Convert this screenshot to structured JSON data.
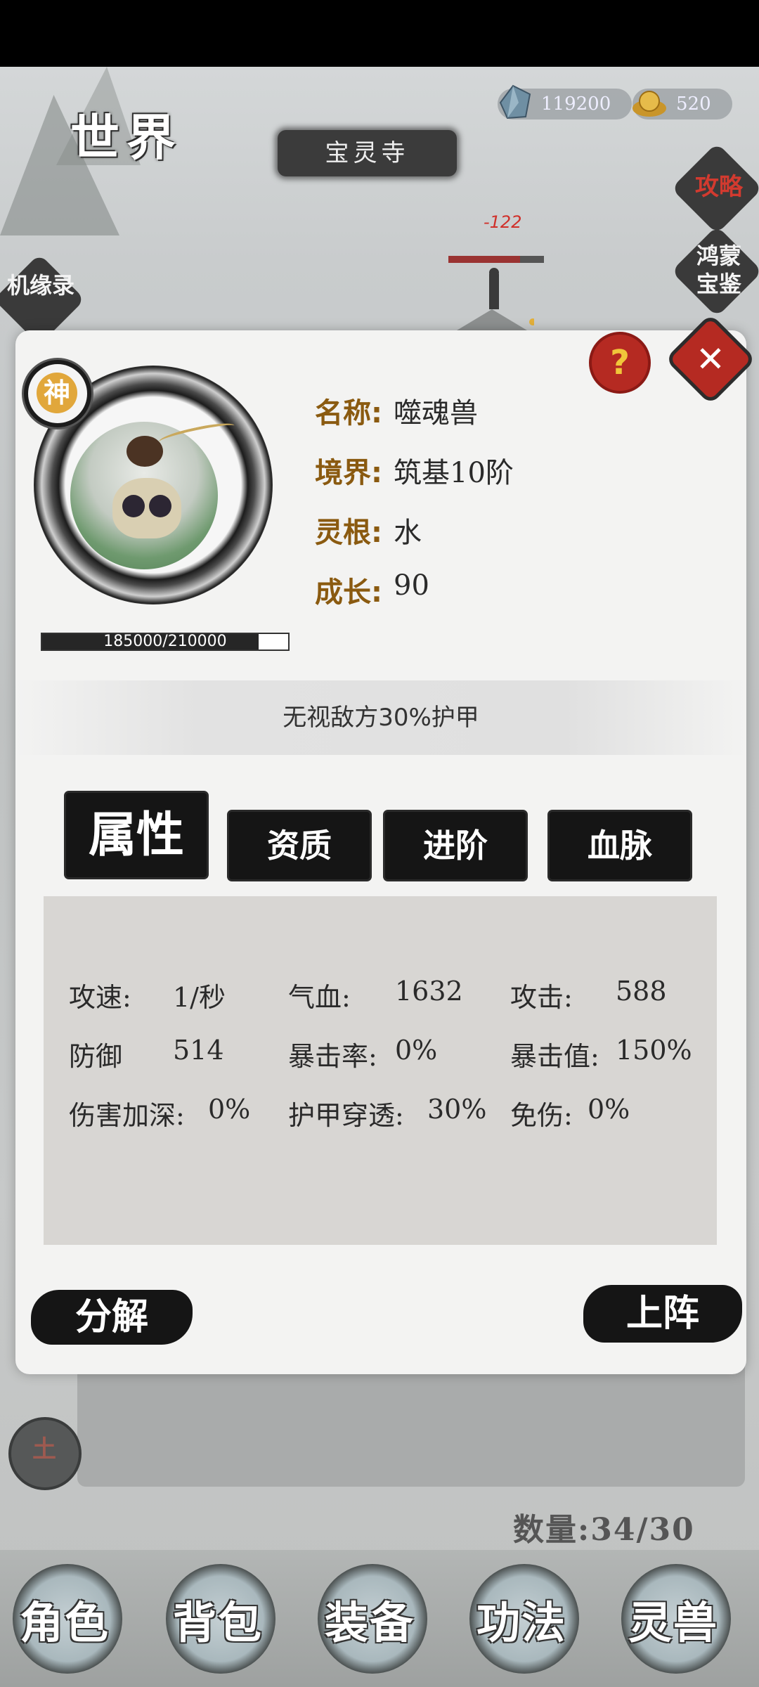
{
  "header": {
    "world_title": "世界",
    "location": "宝灵寺",
    "currencies": [
      {
        "icon": "crystal-icon",
        "value": "119200"
      },
      {
        "icon": "gold-ingot-icon",
        "value": "520"
      }
    ]
  },
  "side_menu": {
    "right": [
      {
        "label": "攻略",
        "color": "#d23a2f"
      },
      {
        "label": "鸿蒙宝鉴"
      }
    ],
    "left": [
      {
        "label": "机缘录"
      }
    ]
  },
  "battle": {
    "damage_text": "-122",
    "enemy_hp_fraction": 0.75
  },
  "pet_detail": {
    "rank_badge": "神",
    "exp_text": "185000/210000",
    "exp_fraction": 0.881,
    "fields": [
      {
        "label": "名称:",
        "value": "噬魂兽"
      },
      {
        "label": "境界:",
        "value": "筑基10阶"
      },
      {
        "label": "灵根:",
        "value": "水"
      },
      {
        "label": "成长:",
        "value": "90"
      }
    ],
    "skill_description": "无视敌方30%护甲",
    "help_label": "?",
    "close_label": "✕",
    "tabs": [
      "属性",
      "资质",
      "进阶",
      "血脉"
    ],
    "active_tab": 0,
    "stats": [
      [
        "攻速:",
        "1/秒"
      ],
      [
        "气血:",
        "1632"
      ],
      [
        "攻击:",
        "588"
      ],
      [
        "防御",
        "514"
      ],
      [
        "暴击率:",
        "0%"
      ],
      [
        "暴击值:",
        "150%"
      ],
      [
        "伤害加深:",
        "0%"
      ],
      [
        "护甲穿透:",
        "30%"
      ],
      [
        "免伤:",
        "0%"
      ]
    ],
    "decompose_label": "分解",
    "deploy_label": "上阵"
  },
  "inventory": {
    "count_label": "数量:34/30",
    "left_circle_label": "土"
  },
  "bottom_nav": [
    "角色",
    "背包",
    "装备",
    "功法",
    "灵兽"
  ],
  "colors": {
    "label_brown": "#8a5a10",
    "close_red": "#b52a22",
    "rank_gold": "#e1a73b",
    "ink_black": "#151515"
  }
}
